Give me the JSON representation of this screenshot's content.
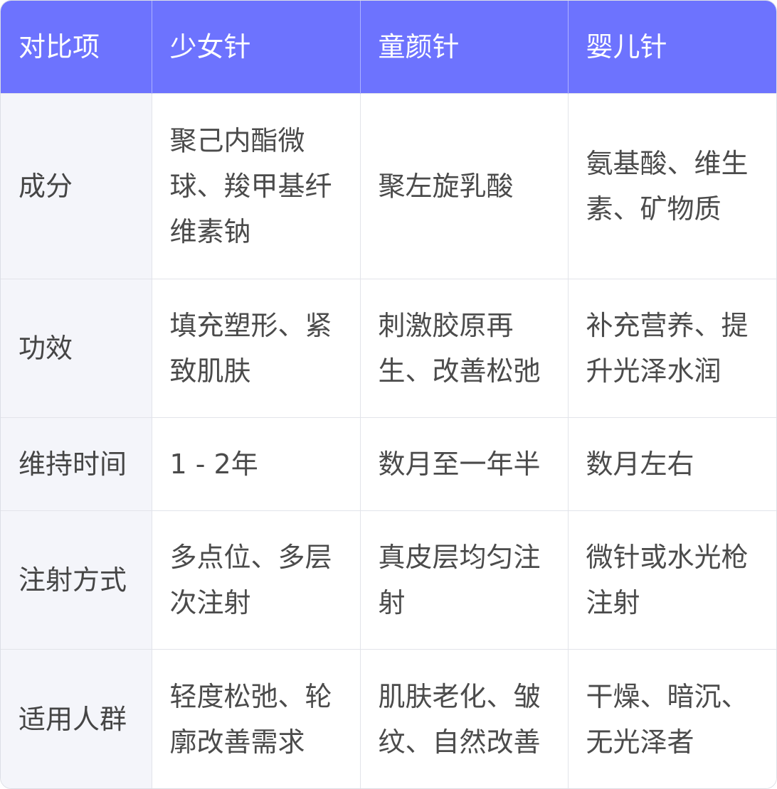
{
  "table": {
    "headers": [
      "对比项",
      "少女针",
      "童颜针",
      "婴儿针"
    ],
    "rows": [
      {
        "label": "成分",
        "cells": [
          "聚己内酯微球、羧甲基纤维素钠",
          "聚左旋乳酸",
          "氨基酸、维生素、矿物质"
        ]
      },
      {
        "label": "功效",
        "cells": [
          "填充塑形、紧致肌肤",
          "刺激胶原再生、改善松弛",
          "补充营养、提升光泽水润"
        ]
      },
      {
        "label": "维持时间",
        "cells": [
          "1 - 2年",
          "数月至一年半",
          "数月左右"
        ]
      },
      {
        "label": "注射方式",
        "cells": [
          "多点位、多层次注射",
          "真皮层均匀注射",
          "微针或水光枪注射"
        ]
      },
      {
        "label": "适用人群",
        "cells": [
          "轻度松弛、轮廓改善需求",
          "肌肤老化、皱纹、自然改善",
          "干燥、暗沉、无光泽者"
        ]
      }
    ]
  },
  "colors": {
    "header_bg": "#6d73fe",
    "header_text": "#ffffff",
    "label_col_bg": "#f4f5fa",
    "body_text": "#4b4b4b",
    "border": "#e2e4ea"
  }
}
